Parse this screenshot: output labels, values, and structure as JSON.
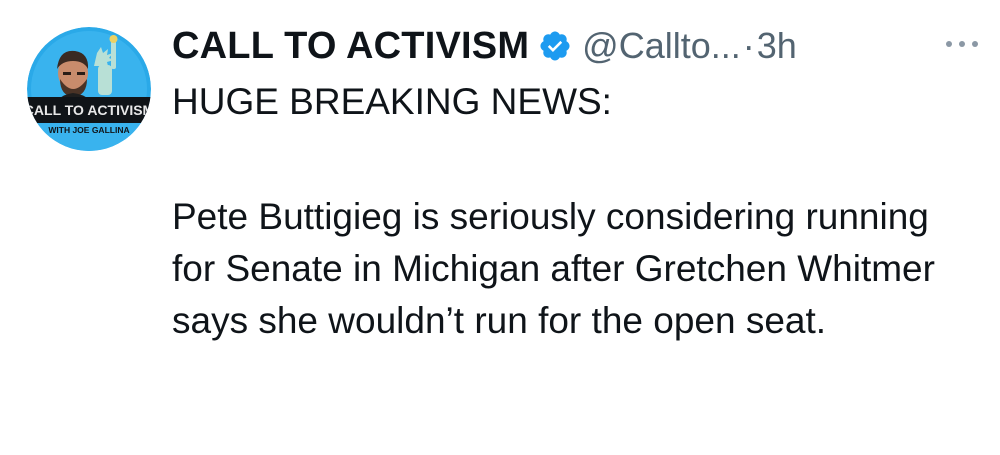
{
  "tweet": {
    "author": {
      "display_name": "CALL TO ACTIVISM",
      "handle": "@Callto...",
      "verified": true,
      "avatar": {
        "icon": "avatar-photo",
        "badge_line1": "CALL TO ACTIVISM",
        "badge_line2": "WITH JOE GALLINA"
      }
    },
    "separator": "·",
    "time": "3h",
    "more_icon": "more-dots-icon",
    "text_line1": "HUGE BREAKING NEWS:",
    "text_body": "Pete Buttigieg is seriously considering running for Senate in Michigan after Gretchen Whitmer says she wouldn’t run for the open seat."
  },
  "colors": {
    "primary_text": "#0f1419",
    "secondary_text": "#536471",
    "verified_blue": "#1d9bf0",
    "avatar_bg": "#2aa9e8"
  }
}
